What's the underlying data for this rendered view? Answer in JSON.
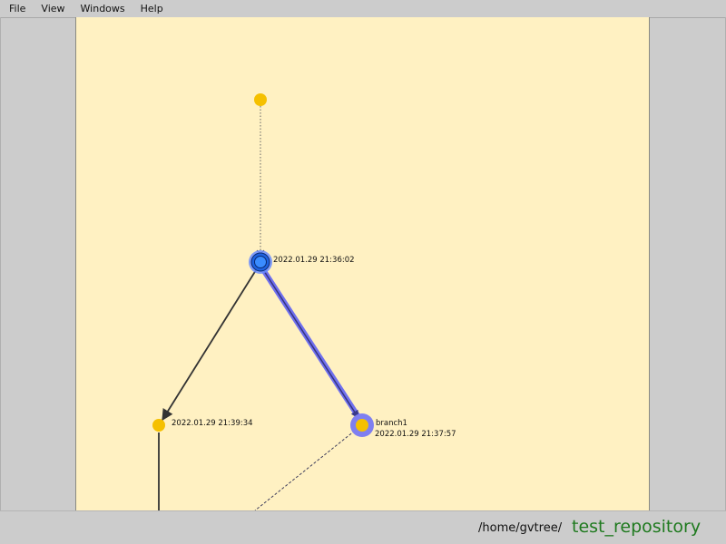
{
  "menu": {
    "file": "File",
    "view": "View",
    "windows": "Windows",
    "help": "Help"
  },
  "graph": {
    "nodes": {
      "root_top": {
        "color": "#f5c000"
      },
      "current": {
        "label": "2022.01.29 21:36:02",
        "color": "#2f7bff",
        "ring_color": "#5a8cff"
      },
      "left": {
        "label": "2022.01.29 21:39:34",
        "color": "#f5c000"
      },
      "branch1": {
        "branch": "branch1",
        "label": "2022.01.29 21:37:57",
        "color": "#f5c000",
        "halo_color": "#7f7ff0"
      }
    },
    "edges": {
      "highlight_color": "#6a6ae8",
      "solid_color": "#333333",
      "dashed_color": "#3a3a5a"
    }
  },
  "status": {
    "path": "/home/gvtree/",
    "repository": "test_repository"
  }
}
